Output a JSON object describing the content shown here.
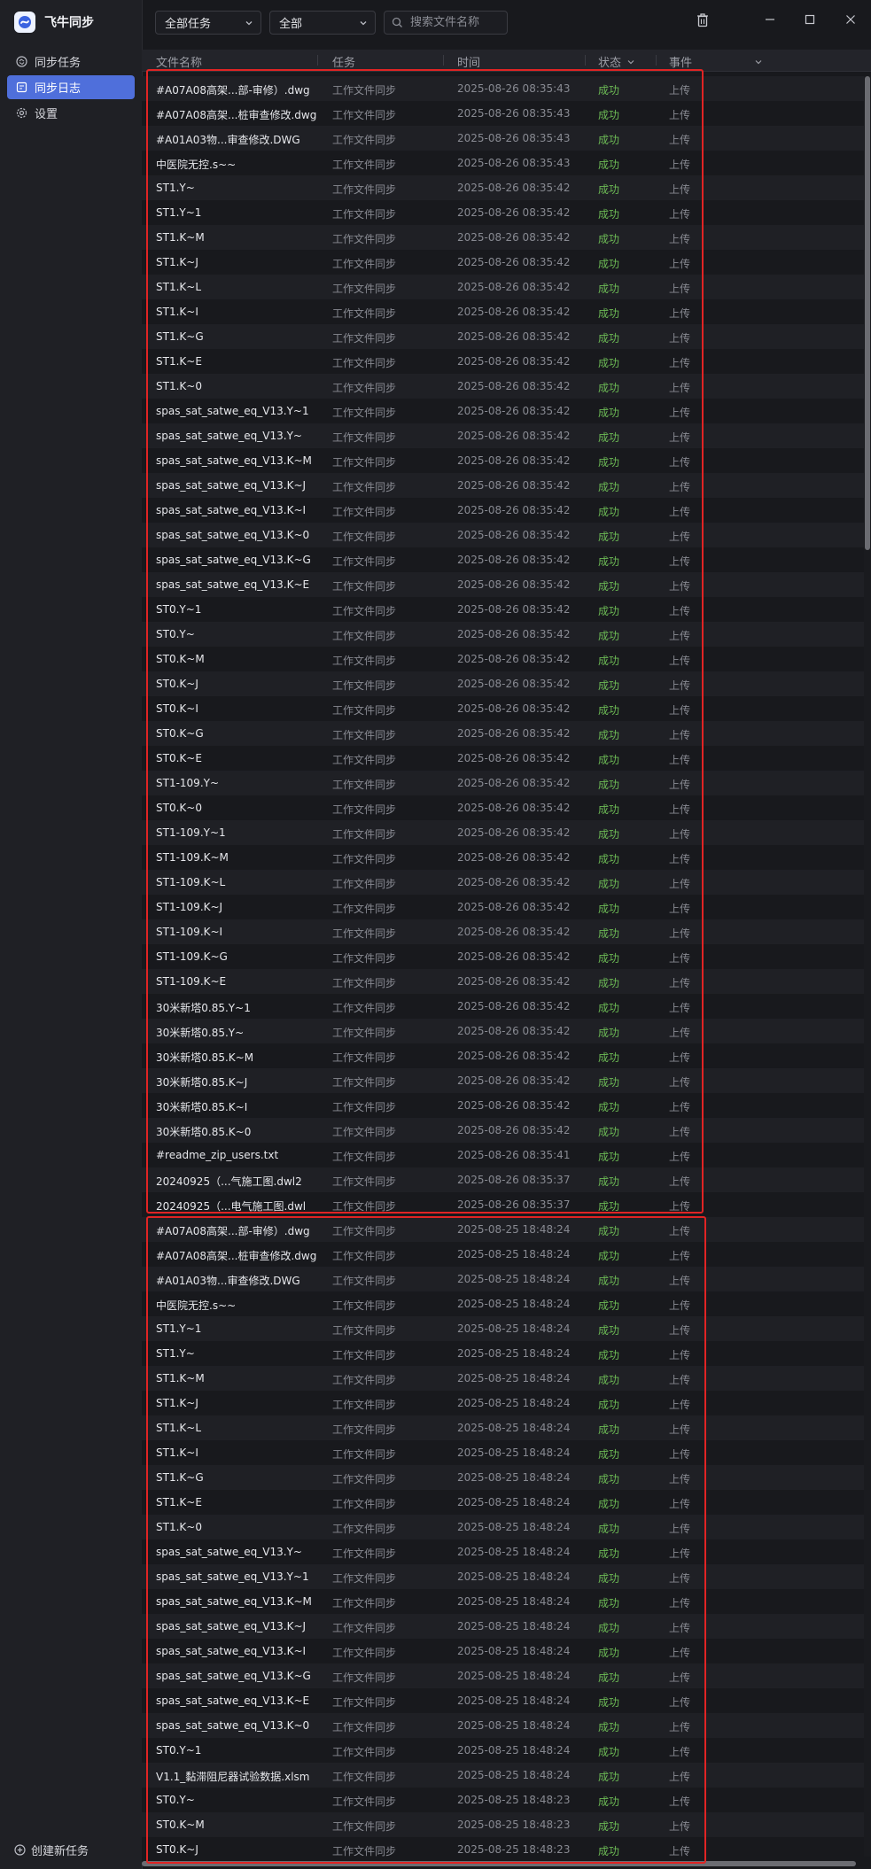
{
  "app": {
    "title": "飞牛同步",
    "logo_icon": "feiniu-logo-icon"
  },
  "sidebar": {
    "items": [
      {
        "label": "同步任务",
        "icon": "sync-task-icon",
        "active": false
      },
      {
        "label": "同步日志",
        "icon": "sync-log-icon",
        "active": true
      },
      {
        "label": "设置",
        "icon": "gear-icon",
        "active": false
      }
    ],
    "create_label": "创建新任务"
  },
  "toolbar": {
    "task_filter": "全部任务",
    "status_filter": "全部",
    "search_placeholder": "搜索文件名称"
  },
  "table": {
    "headers": {
      "name": "文件名称",
      "task": "任务",
      "time": "时间",
      "status": "状态",
      "event": "事件"
    },
    "rows": [
      {
        "name": "#A07A08高架...部-审修）.dwg",
        "task": "工作文件同步",
        "time": "2025-08-26 08:35:43",
        "status": "成功",
        "event": "上传"
      },
      {
        "name": "#A07A08高架...桩审查修改.dwg",
        "task": "工作文件同步",
        "time": "2025-08-26 08:35:43",
        "status": "成功",
        "event": "上传"
      },
      {
        "name": "#A01A03物...审查修改.DWG",
        "task": "工作文件同步",
        "time": "2025-08-26 08:35:43",
        "status": "成功",
        "event": "上传"
      },
      {
        "name": "中医院无控.s~~",
        "task": "工作文件同步",
        "time": "2025-08-26 08:35:43",
        "status": "成功",
        "event": "上传"
      },
      {
        "name": "ST1.Y~",
        "task": "工作文件同步",
        "time": "2025-08-26 08:35:42",
        "status": "成功",
        "event": "上传"
      },
      {
        "name": "ST1.Y~1",
        "task": "工作文件同步",
        "time": "2025-08-26 08:35:42",
        "status": "成功",
        "event": "上传"
      },
      {
        "name": "ST1.K~M",
        "task": "工作文件同步",
        "time": "2025-08-26 08:35:42",
        "status": "成功",
        "event": "上传"
      },
      {
        "name": "ST1.K~J",
        "task": "工作文件同步",
        "time": "2025-08-26 08:35:42",
        "status": "成功",
        "event": "上传"
      },
      {
        "name": "ST1.K~L",
        "task": "工作文件同步",
        "time": "2025-08-26 08:35:42",
        "status": "成功",
        "event": "上传"
      },
      {
        "name": "ST1.K~I",
        "task": "工作文件同步",
        "time": "2025-08-26 08:35:42",
        "status": "成功",
        "event": "上传"
      },
      {
        "name": "ST1.K~G",
        "task": "工作文件同步",
        "time": "2025-08-26 08:35:42",
        "status": "成功",
        "event": "上传"
      },
      {
        "name": "ST1.K~E",
        "task": "工作文件同步",
        "time": "2025-08-26 08:35:42",
        "status": "成功",
        "event": "上传"
      },
      {
        "name": "ST1.K~0",
        "task": "工作文件同步",
        "time": "2025-08-26 08:35:42",
        "status": "成功",
        "event": "上传"
      },
      {
        "name": "spas_sat_satwe_eq_V13.Y~1",
        "task": "工作文件同步",
        "time": "2025-08-26 08:35:42",
        "status": "成功",
        "event": "上传"
      },
      {
        "name": "spas_sat_satwe_eq_V13.Y~",
        "task": "工作文件同步",
        "time": "2025-08-26 08:35:42",
        "status": "成功",
        "event": "上传"
      },
      {
        "name": "spas_sat_satwe_eq_V13.K~M",
        "task": "工作文件同步",
        "time": "2025-08-26 08:35:42",
        "status": "成功",
        "event": "上传"
      },
      {
        "name": "spas_sat_satwe_eq_V13.K~J",
        "task": "工作文件同步",
        "time": "2025-08-26 08:35:42",
        "status": "成功",
        "event": "上传"
      },
      {
        "name": "spas_sat_satwe_eq_V13.K~I",
        "task": "工作文件同步",
        "time": "2025-08-26 08:35:42",
        "status": "成功",
        "event": "上传"
      },
      {
        "name": "spas_sat_satwe_eq_V13.K~0",
        "task": "工作文件同步",
        "time": "2025-08-26 08:35:42",
        "status": "成功",
        "event": "上传"
      },
      {
        "name": "spas_sat_satwe_eq_V13.K~G",
        "task": "工作文件同步",
        "time": "2025-08-26 08:35:42",
        "status": "成功",
        "event": "上传"
      },
      {
        "name": "spas_sat_satwe_eq_V13.K~E",
        "task": "工作文件同步",
        "time": "2025-08-26 08:35:42",
        "status": "成功",
        "event": "上传"
      },
      {
        "name": "ST0.Y~1",
        "task": "工作文件同步",
        "time": "2025-08-26 08:35:42",
        "status": "成功",
        "event": "上传"
      },
      {
        "name": "ST0.Y~",
        "task": "工作文件同步",
        "time": "2025-08-26 08:35:42",
        "status": "成功",
        "event": "上传"
      },
      {
        "name": "ST0.K~M",
        "task": "工作文件同步",
        "time": "2025-08-26 08:35:42",
        "status": "成功",
        "event": "上传"
      },
      {
        "name": "ST0.K~J",
        "task": "工作文件同步",
        "time": "2025-08-26 08:35:42",
        "status": "成功",
        "event": "上传"
      },
      {
        "name": "ST0.K~I",
        "task": "工作文件同步",
        "time": "2025-08-26 08:35:42",
        "status": "成功",
        "event": "上传"
      },
      {
        "name": "ST0.K~G",
        "task": "工作文件同步",
        "time": "2025-08-26 08:35:42",
        "status": "成功",
        "event": "上传"
      },
      {
        "name": "ST0.K~E",
        "task": "工作文件同步",
        "time": "2025-08-26 08:35:42",
        "status": "成功",
        "event": "上传"
      },
      {
        "name": "ST1-109.Y~",
        "task": "工作文件同步",
        "time": "2025-08-26 08:35:42",
        "status": "成功",
        "event": "上传"
      },
      {
        "name": "ST0.K~0",
        "task": "工作文件同步",
        "time": "2025-08-26 08:35:42",
        "status": "成功",
        "event": "上传"
      },
      {
        "name": "ST1-109.Y~1",
        "task": "工作文件同步",
        "time": "2025-08-26 08:35:42",
        "status": "成功",
        "event": "上传"
      },
      {
        "name": "ST1-109.K~M",
        "task": "工作文件同步",
        "time": "2025-08-26 08:35:42",
        "status": "成功",
        "event": "上传"
      },
      {
        "name": "ST1-109.K~L",
        "task": "工作文件同步",
        "time": "2025-08-26 08:35:42",
        "status": "成功",
        "event": "上传"
      },
      {
        "name": "ST1-109.K~J",
        "task": "工作文件同步",
        "time": "2025-08-26 08:35:42",
        "status": "成功",
        "event": "上传"
      },
      {
        "name": "ST1-109.K~I",
        "task": "工作文件同步",
        "time": "2025-08-26 08:35:42",
        "status": "成功",
        "event": "上传"
      },
      {
        "name": "ST1-109.K~G",
        "task": "工作文件同步",
        "time": "2025-08-26 08:35:42",
        "status": "成功",
        "event": "上传"
      },
      {
        "name": "ST1-109.K~E",
        "task": "工作文件同步",
        "time": "2025-08-26 08:35:42",
        "status": "成功",
        "event": "上传"
      },
      {
        "name": "30米新塔0.85.Y~1",
        "task": "工作文件同步",
        "time": "2025-08-26 08:35:42",
        "status": "成功",
        "event": "上传"
      },
      {
        "name": "30米新塔0.85.Y~",
        "task": "工作文件同步",
        "time": "2025-08-26 08:35:42",
        "status": "成功",
        "event": "上传"
      },
      {
        "name": "30米新塔0.85.K~M",
        "task": "工作文件同步",
        "time": "2025-08-26 08:35:42",
        "status": "成功",
        "event": "上传"
      },
      {
        "name": "30米新塔0.85.K~J",
        "task": "工作文件同步",
        "time": "2025-08-26 08:35:42",
        "status": "成功",
        "event": "上传"
      },
      {
        "name": "30米新塔0.85.K~I",
        "task": "工作文件同步",
        "time": "2025-08-26 08:35:42",
        "status": "成功",
        "event": "上传"
      },
      {
        "name": "30米新塔0.85.K~0",
        "task": "工作文件同步",
        "time": "2025-08-26 08:35:42",
        "status": "成功",
        "event": "上传"
      },
      {
        "name": "#readme_zip_users.txt",
        "task": "工作文件同步",
        "time": "2025-08-26 08:35:41",
        "status": "成功",
        "event": "上传"
      },
      {
        "name": "20240925（...气施工图.dwl2",
        "task": "工作文件同步",
        "time": "2025-08-26 08:35:37",
        "status": "成功",
        "event": "上传"
      },
      {
        "name": "20240925（...电气施工图.dwl",
        "task": "工作文件同步",
        "time": "2025-08-26 08:35:37",
        "status": "成功",
        "event": "上传"
      },
      {
        "name": "#A07A08高架...部-审修）.dwg",
        "task": "工作文件同步",
        "time": "2025-08-25 18:48:24",
        "status": "成功",
        "event": "上传"
      },
      {
        "name": "#A07A08高架...桩审查修改.dwg",
        "task": "工作文件同步",
        "time": "2025-08-25 18:48:24",
        "status": "成功",
        "event": "上传"
      },
      {
        "name": "#A01A03物...审查修改.DWG",
        "task": "工作文件同步",
        "time": "2025-08-25 18:48:24",
        "status": "成功",
        "event": "上传"
      },
      {
        "name": "中医院无控.s~~",
        "task": "工作文件同步",
        "time": "2025-08-25 18:48:24",
        "status": "成功",
        "event": "上传"
      },
      {
        "name": "ST1.Y~1",
        "task": "工作文件同步",
        "time": "2025-08-25 18:48:24",
        "status": "成功",
        "event": "上传"
      },
      {
        "name": "ST1.Y~",
        "task": "工作文件同步",
        "time": "2025-08-25 18:48:24",
        "status": "成功",
        "event": "上传"
      },
      {
        "name": "ST1.K~M",
        "task": "工作文件同步",
        "time": "2025-08-25 18:48:24",
        "status": "成功",
        "event": "上传"
      },
      {
        "name": "ST1.K~J",
        "task": "工作文件同步",
        "time": "2025-08-25 18:48:24",
        "status": "成功",
        "event": "上传"
      },
      {
        "name": "ST1.K~L",
        "task": "工作文件同步",
        "time": "2025-08-25 18:48:24",
        "status": "成功",
        "event": "上传"
      },
      {
        "name": "ST1.K~I",
        "task": "工作文件同步",
        "time": "2025-08-25 18:48:24",
        "status": "成功",
        "event": "上传"
      },
      {
        "name": "ST1.K~G",
        "task": "工作文件同步",
        "time": "2025-08-25 18:48:24",
        "status": "成功",
        "event": "上传"
      },
      {
        "name": "ST1.K~E",
        "task": "工作文件同步",
        "time": "2025-08-25 18:48:24",
        "status": "成功",
        "event": "上传"
      },
      {
        "name": "ST1.K~0",
        "task": "工作文件同步",
        "time": "2025-08-25 18:48:24",
        "status": "成功",
        "event": "上传"
      },
      {
        "name": "spas_sat_satwe_eq_V13.Y~",
        "task": "工作文件同步",
        "time": "2025-08-25 18:48:24",
        "status": "成功",
        "event": "上传"
      },
      {
        "name": "spas_sat_satwe_eq_V13.Y~1",
        "task": "工作文件同步",
        "time": "2025-08-25 18:48:24",
        "status": "成功",
        "event": "上传"
      },
      {
        "name": "spas_sat_satwe_eq_V13.K~M",
        "task": "工作文件同步",
        "time": "2025-08-25 18:48:24",
        "status": "成功",
        "event": "上传"
      },
      {
        "name": "spas_sat_satwe_eq_V13.K~J",
        "task": "工作文件同步",
        "time": "2025-08-25 18:48:24",
        "status": "成功",
        "event": "上传"
      },
      {
        "name": "spas_sat_satwe_eq_V13.K~I",
        "task": "工作文件同步",
        "time": "2025-08-25 18:48:24",
        "status": "成功",
        "event": "上传"
      },
      {
        "name": "spas_sat_satwe_eq_V13.K~G",
        "task": "工作文件同步",
        "time": "2025-08-25 18:48:24",
        "status": "成功",
        "event": "上传"
      },
      {
        "name": "spas_sat_satwe_eq_V13.K~E",
        "task": "工作文件同步",
        "time": "2025-08-25 18:48:24",
        "status": "成功",
        "event": "上传"
      },
      {
        "name": "spas_sat_satwe_eq_V13.K~0",
        "task": "工作文件同步",
        "time": "2025-08-25 18:48:24",
        "status": "成功",
        "event": "上传"
      },
      {
        "name": "ST0.Y~1",
        "task": "工作文件同步",
        "time": "2025-08-25 18:48:24",
        "status": "成功",
        "event": "上传"
      },
      {
        "name": "V1.1_黏滞阻尼器试验数据.xlsm",
        "task": "工作文件同步",
        "time": "2025-08-25 18:48:24",
        "status": "成功",
        "event": "上传"
      },
      {
        "name": "ST0.Y~",
        "task": "工作文件同步",
        "time": "2025-08-25 18:48:23",
        "status": "成功",
        "event": "上传"
      },
      {
        "name": "ST0.K~M",
        "task": "工作文件同步",
        "time": "2025-08-25 18:48:23",
        "status": "成功",
        "event": "上传"
      },
      {
        "name": "ST0.K~J",
        "task": "工作文件同步",
        "time": "2025-08-25 18:48:23",
        "status": "成功",
        "event": "上传"
      }
    ]
  },
  "colors": {
    "accent": "#4f6fdb",
    "success": "#6cba55",
    "highlight": "#e02424"
  }
}
